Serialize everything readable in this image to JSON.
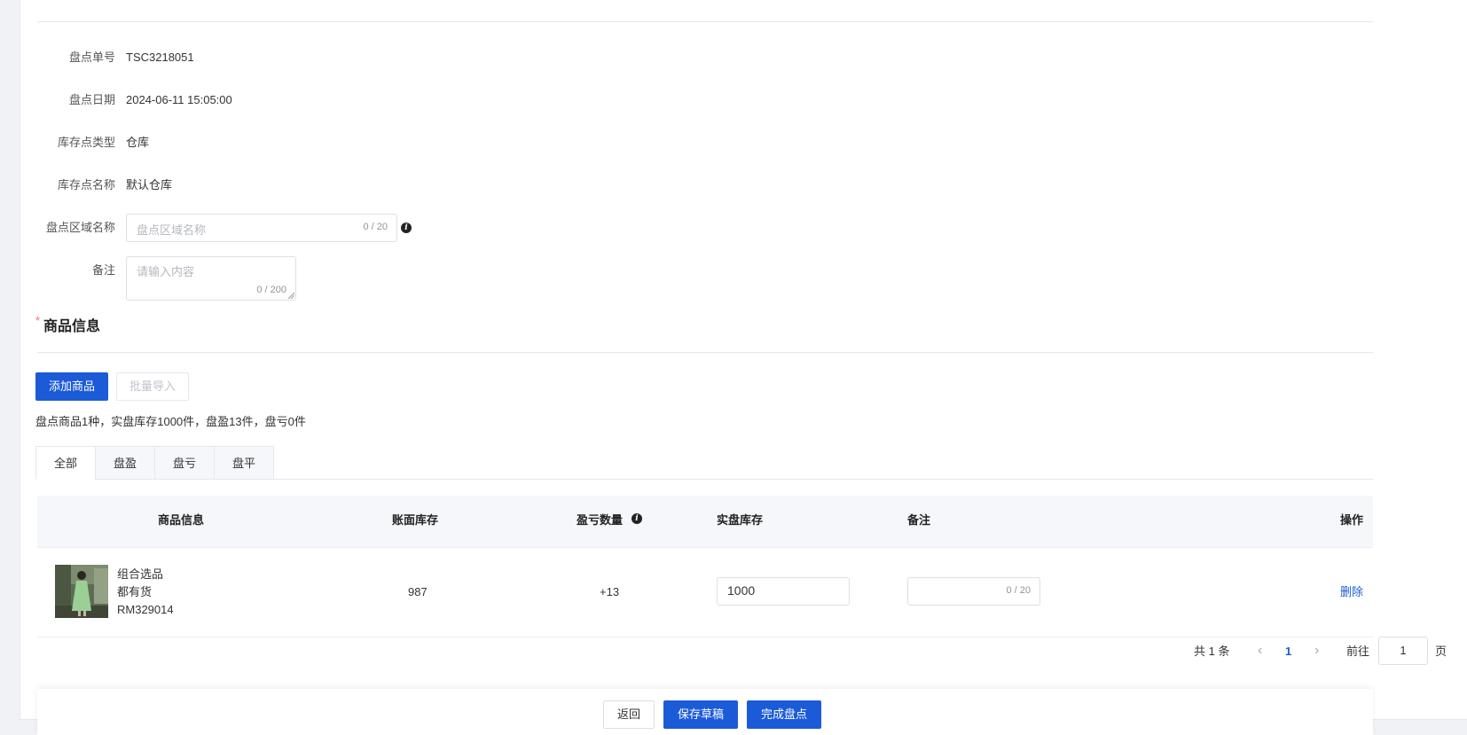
{
  "form": {
    "order_no": {
      "label": "盘点单号",
      "value": "TSC3218051"
    },
    "date": {
      "label": "盘点日期",
      "value": "2024-06-11 15:05:00"
    },
    "location_type": {
      "label": "库存点类型",
      "value": "仓库"
    },
    "location_name": {
      "label": "库存点名称",
      "value": "默认仓库"
    },
    "area_name": {
      "label": "盘点区域名称",
      "placeholder": "盘点区域名称",
      "counter": "0 / 20"
    },
    "remark": {
      "label": "备注",
      "placeholder": "请输入内容",
      "counter": "0 / 200"
    }
  },
  "section": {
    "required_mark": "*",
    "title": "商品信息"
  },
  "toolbar": {
    "add_label": "添加商品",
    "import_label": "批量导入"
  },
  "summary": "盘点商品1种，实盘库存1000件，盘盈13件，盘亏0件",
  "tabs": [
    {
      "label": "全部",
      "active": true
    },
    {
      "label": "盘盈",
      "active": false
    },
    {
      "label": "盘亏",
      "active": false
    },
    {
      "label": "盘平",
      "active": false
    }
  ],
  "table": {
    "headers": {
      "product": "商品信息",
      "book_stock": "账面库存",
      "diff_qty": "盈亏数量",
      "actual_stock": "实盘库存",
      "remark": "备注",
      "action": "操作"
    },
    "rows": [
      {
        "name": "组合选品",
        "stock_status": "都有货",
        "code": "RM329014",
        "book_stock": "987",
        "diff": "+13",
        "actual_stock": "1000",
        "remark_counter": "0 / 20",
        "action": "删除"
      }
    ]
  },
  "pagination": {
    "total": "共 1 条",
    "prev": "‹",
    "current": "1",
    "next": "›",
    "goto_label": "前往",
    "goto_value": "1",
    "page_suffix": "页"
  },
  "footer": {
    "back": "返回",
    "save_draft": "保存草稿",
    "complete": "完成盘点"
  },
  "colors": {
    "primary": "#1c5bd8",
    "link": "#1c5bd8",
    "required": "#f56c6c"
  }
}
